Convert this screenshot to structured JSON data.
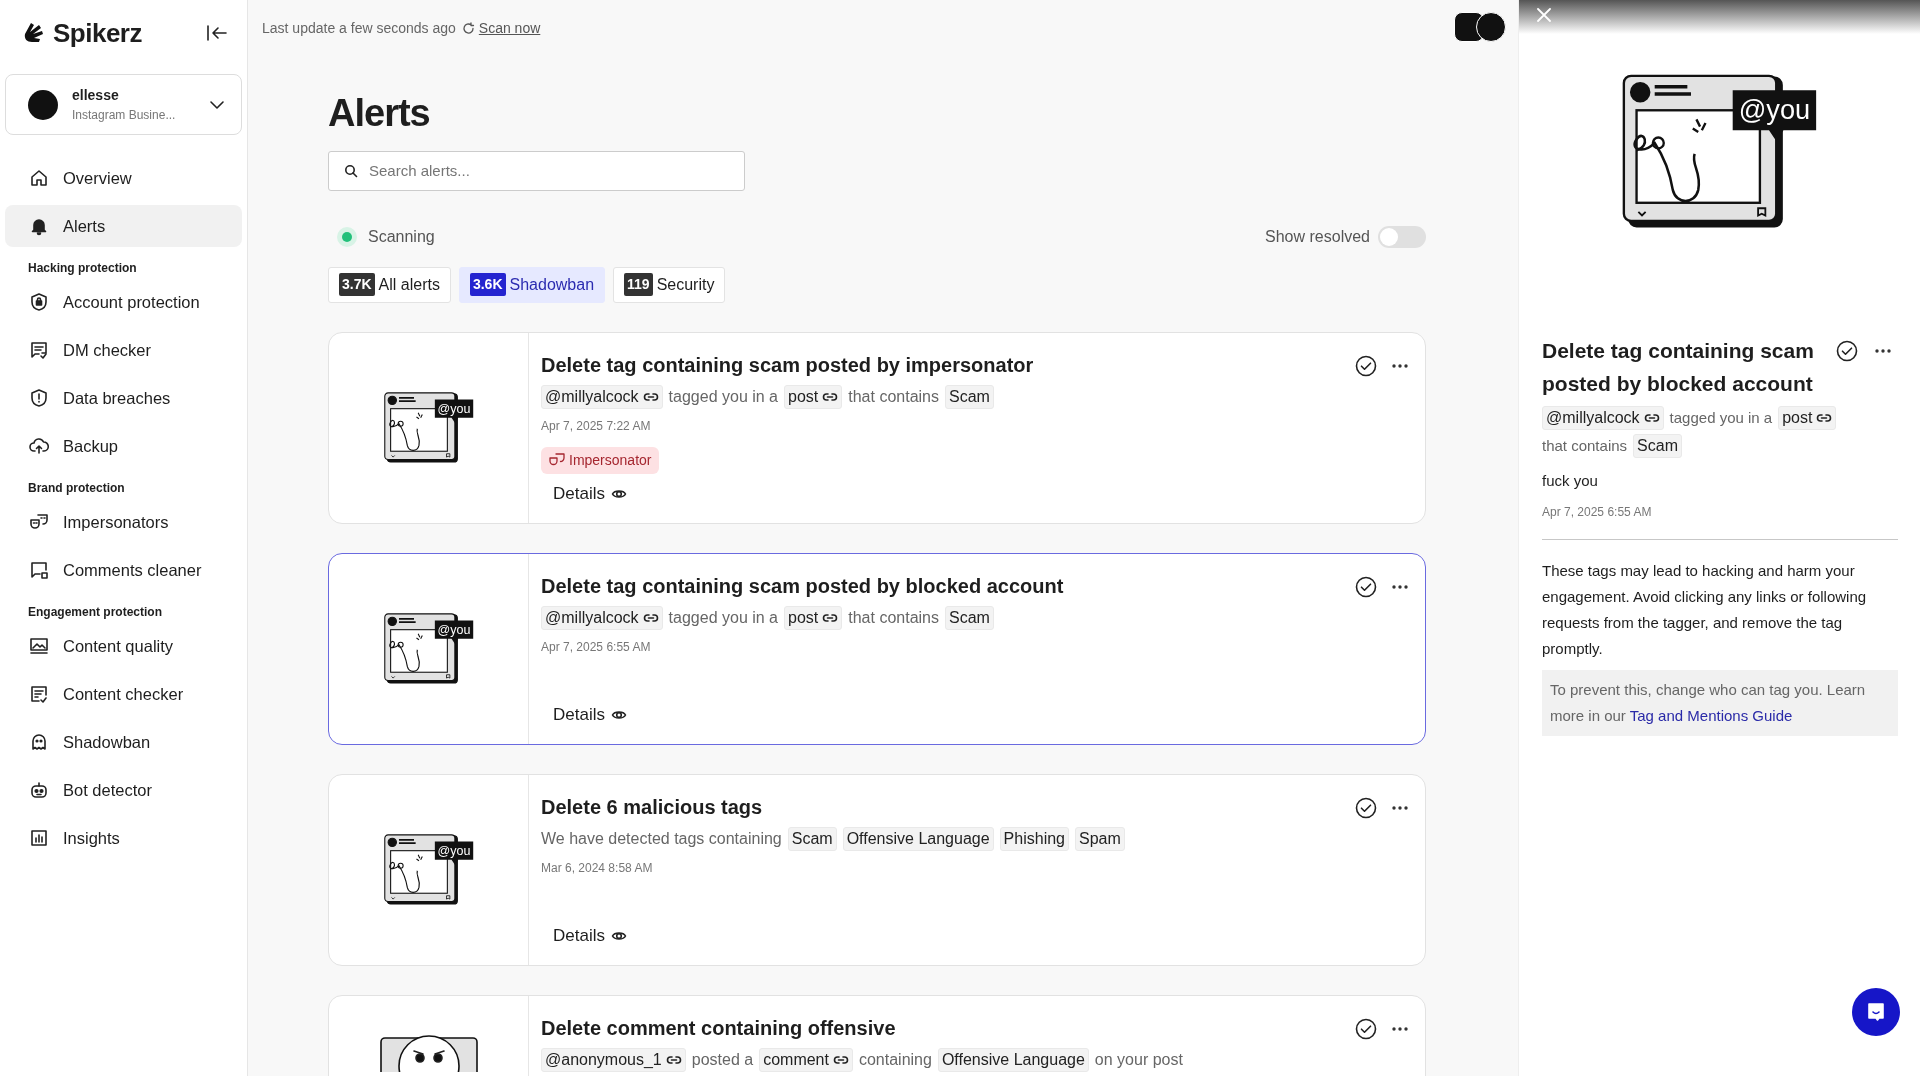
{
  "brand": {
    "name": "Spikerz"
  },
  "account": {
    "name": "ellesse",
    "type": "Instagram Busine..."
  },
  "nav": [
    {
      "kind": "item",
      "label": "Overview",
      "selected": false
    },
    {
      "kind": "item",
      "label": "Alerts",
      "selected": true
    },
    {
      "kind": "heading",
      "label": "Hacking protection"
    },
    {
      "kind": "item",
      "label": "Account protection",
      "selected": false
    },
    {
      "kind": "item",
      "label": "DM checker",
      "selected": false
    },
    {
      "kind": "item",
      "label": "Data breaches",
      "selected": false
    },
    {
      "kind": "item",
      "label": "Backup",
      "selected": false
    },
    {
      "kind": "heading",
      "label": "Brand protection"
    },
    {
      "kind": "item",
      "label": "Impersonators",
      "selected": false
    },
    {
      "kind": "item",
      "label": "Comments cleaner",
      "selected": false
    },
    {
      "kind": "heading",
      "label": "Engagement protection"
    },
    {
      "kind": "item",
      "label": "Content quality",
      "selected": false
    },
    {
      "kind": "item",
      "label": "Content checker",
      "selected": false
    },
    {
      "kind": "item",
      "label": "Shadowban",
      "selected": false
    },
    {
      "kind": "item",
      "label": "Bot detector",
      "selected": false
    },
    {
      "kind": "item",
      "label": "Insights",
      "selected": false
    }
  ],
  "topbar": {
    "last_update": "Last update a few seconds ago",
    "scan_now": "Scan now"
  },
  "page_title": "Alerts",
  "search": {
    "placeholder": "Search alerts..."
  },
  "status": {
    "label": "Scanning",
    "color": "#22c07a"
  },
  "show_resolved": {
    "label": "Show resolved",
    "on": false
  },
  "tabs": [
    {
      "count": "3.7K",
      "label": "All alerts",
      "selected": false
    },
    {
      "count": "3.6K",
      "label": "Shadowban",
      "selected": true
    },
    {
      "count": "119",
      "label": "Security",
      "selected": false
    }
  ],
  "cards": [
    {
      "kind": "tag",
      "illustration_label": "@you",
      "title": "Delete tag containing scam posted by impersonator",
      "selected": false,
      "parts": [
        {
          "kind": "chip",
          "text": "@millyalcock",
          "link": true
        },
        {
          "kind": "text",
          "text": "tagged you in a"
        },
        {
          "kind": "chip",
          "text": "post",
          "link": true
        },
        {
          "kind": "text",
          "text": "that contains"
        },
        {
          "kind": "chip",
          "text": "Scam",
          "link": false
        }
      ],
      "date": "Apr 7, 2025 7:22 AM",
      "tag": "Impersonator",
      "details": "Details"
    },
    {
      "kind": "tag",
      "illustration_label": "@you",
      "title": "Delete tag containing scam posted by blocked account",
      "selected": true,
      "parts": [
        {
          "kind": "chip",
          "text": "@millyalcock",
          "link": true
        },
        {
          "kind": "text",
          "text": "tagged you in a"
        },
        {
          "kind": "chip",
          "text": "post",
          "link": true
        },
        {
          "kind": "text",
          "text": "that contains"
        },
        {
          "kind": "chip",
          "text": "Scam",
          "link": false
        }
      ],
      "date": "Apr 7, 2025 6:55 AM",
      "details": "Details"
    },
    {
      "kind": "tag",
      "illustration_label": "@you",
      "title": "Delete 6 malicious tags",
      "selected": false,
      "parts": [
        {
          "kind": "text",
          "text": "We have detected tags containing"
        },
        {
          "kind": "chip",
          "text": "Scam",
          "link": false
        },
        {
          "kind": "chip",
          "text": "Offensive Language",
          "link": false
        },
        {
          "kind": "chip",
          "text": "Phishing",
          "link": false
        },
        {
          "kind": "chip",
          "text": "Spam",
          "link": false
        }
      ],
      "date": "Mar 6, 2024 8:58 AM",
      "details": "Details"
    },
    {
      "kind": "comment",
      "title": "Delete comment containing offensive",
      "selected": false,
      "parts": [
        {
          "kind": "chip",
          "text": "@anonymous_1",
          "link": true
        },
        {
          "kind": "text",
          "text": "posted a"
        },
        {
          "kind": "chip",
          "text": "comment",
          "link": true
        },
        {
          "kind": "text",
          "text": "containing"
        },
        {
          "kind": "chip",
          "text": "Offensive Language",
          "link": false
        },
        {
          "kind": "text",
          "text": "on your post"
        }
      ]
    }
  ],
  "panel": {
    "illustration_label": "@you",
    "title": "Delete tag containing scam posted by blocked account",
    "parts": [
      {
        "kind": "chip",
        "text": "@millyalcock",
        "link": true
      },
      {
        "kind": "text",
        "text": "tagged you in a"
      },
      {
        "kind": "chip",
        "text": "post",
        "link": true
      },
      {
        "kind": "text",
        "text": "that contains"
      },
      {
        "kind": "chip",
        "text": "Scam",
        "link": false
      }
    ],
    "message": "fuck you",
    "date": "Apr 7, 2025 6:55 AM",
    "explanation": "These tags may lead to hacking and harm your engagement. Avoid clicking any links or following requests from the tagger, and remove the tag promptly.",
    "tip": "To prevent this, change who can tag you. Learn more in our",
    "tip_link": "Tag and Mentions Guide"
  }
}
